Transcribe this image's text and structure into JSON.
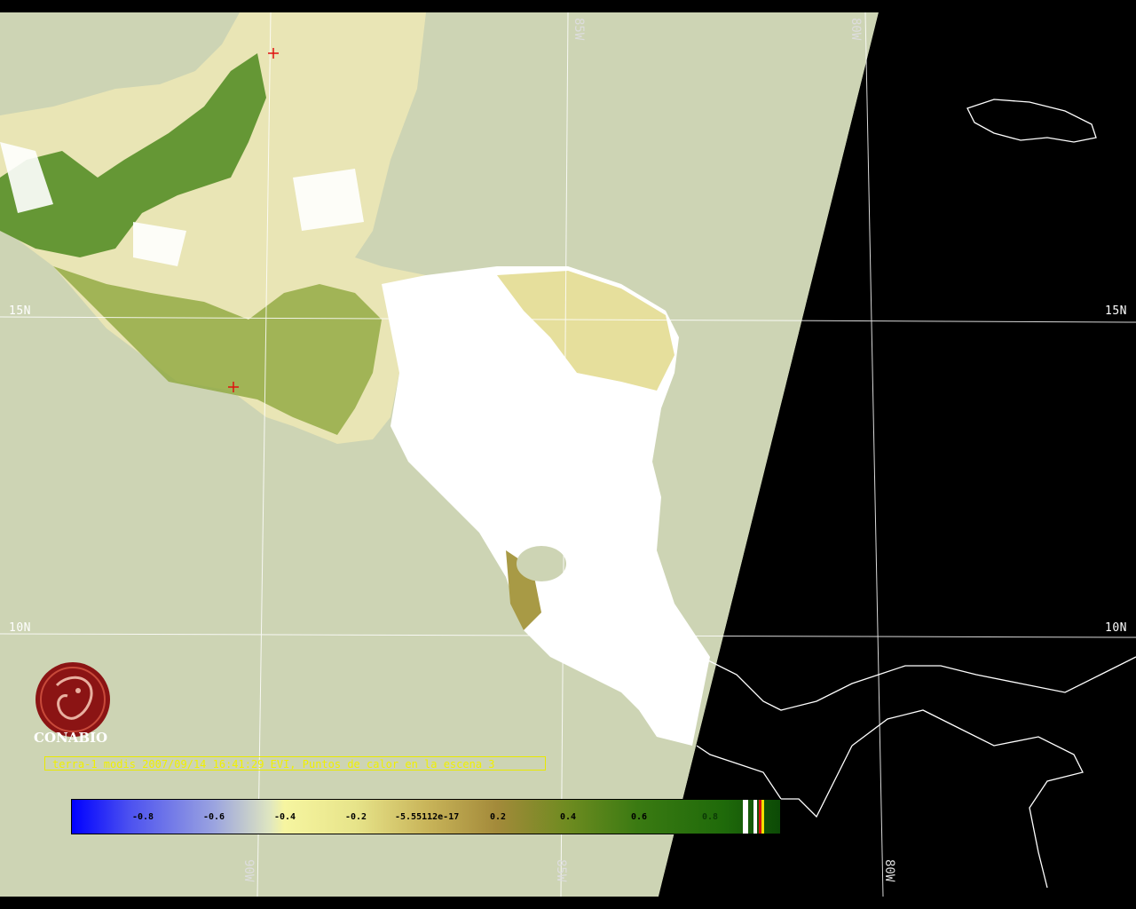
{
  "map": {
    "lat_labels_left": [
      "15N",
      "10N"
    ],
    "lat_labels_right": [
      "15N",
      "10N"
    ],
    "lon_labels_top": [
      "85W",
      "80W"
    ],
    "lon_labels_bottom": [
      "90W",
      "85W",
      "80W"
    ]
  },
  "logo": {
    "text": "CONABIO"
  },
  "caption": {
    "text": "terra-1 modis 2007/09/14 16:41:29 EVI, Puntos de calor en la escena 3"
  },
  "scale": {
    "ticks": [
      "-0.8",
      "-0.6",
      "-0.4",
      "-0.2",
      "-5.55112e-17",
      "0.2",
      "0.4",
      "0.6",
      "0.8"
    ]
  },
  "colors": {
    "ocean": "#cdd4b4",
    "land_unclassified": "#ffffff",
    "vegetation": "#3e7a1a",
    "night_side": "#000000",
    "grid": "#ffffff",
    "caption_color": "#f0f000",
    "logo_red": "#8b1414"
  }
}
